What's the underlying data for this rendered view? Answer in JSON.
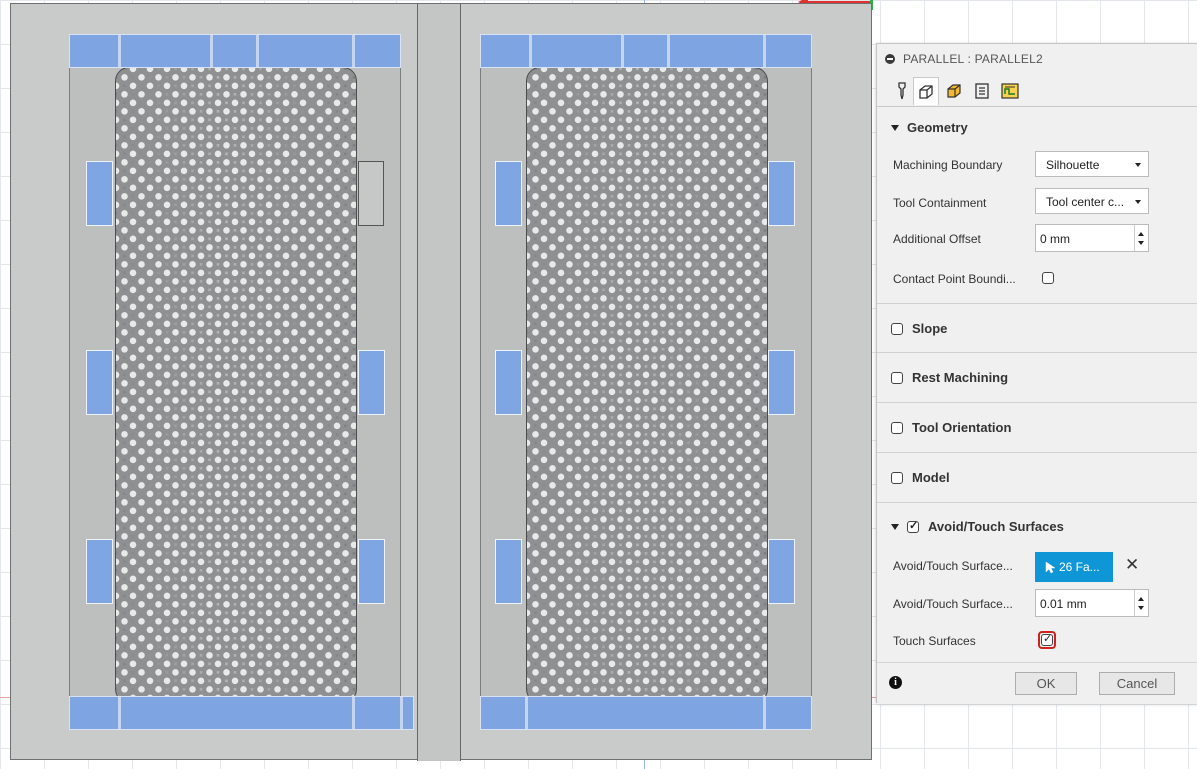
{
  "dialog": {
    "title": "PARALLEL : PARALLEL2",
    "tabs": [
      "tool-tab",
      "geometry-tab",
      "heights-tab",
      "passes-tab",
      "linking-tab"
    ],
    "active_tab": 1,
    "geometry": {
      "label": "Geometry",
      "machining_boundary_label": "Machining Boundary",
      "machining_boundary_value": "Silhouette",
      "tool_containment_label": "Tool Containment",
      "tool_containment_value": "Tool center c...",
      "additional_offset_label": "Additional Offset",
      "additional_offset_value": "0 mm",
      "contact_point_label": "Contact Point Boundi...",
      "contact_point_checked": false
    },
    "sections": {
      "slope": "Slope",
      "rest_machining": "Rest Machining",
      "tool_orientation": "Tool Orientation",
      "model": "Model"
    },
    "avoid_touch": {
      "label": "Avoid/Touch Surfaces",
      "checked": true,
      "surfaces_label": "Avoid/Touch Surface...",
      "surfaces_value": "26 Fa...",
      "clearance_label": "Avoid/Touch Surface...",
      "clearance_value": "0.01 mm",
      "touch_surfaces_label": "Touch Surfaces",
      "touch_surfaces_checked": true
    },
    "footer": {
      "ok_label": "OK",
      "cancel_label": "Cancel"
    }
  },
  "colors": {
    "selected_face": "#7fa6e3",
    "select_button": "#0f96d6",
    "highlight_ring": "#d02020"
  }
}
